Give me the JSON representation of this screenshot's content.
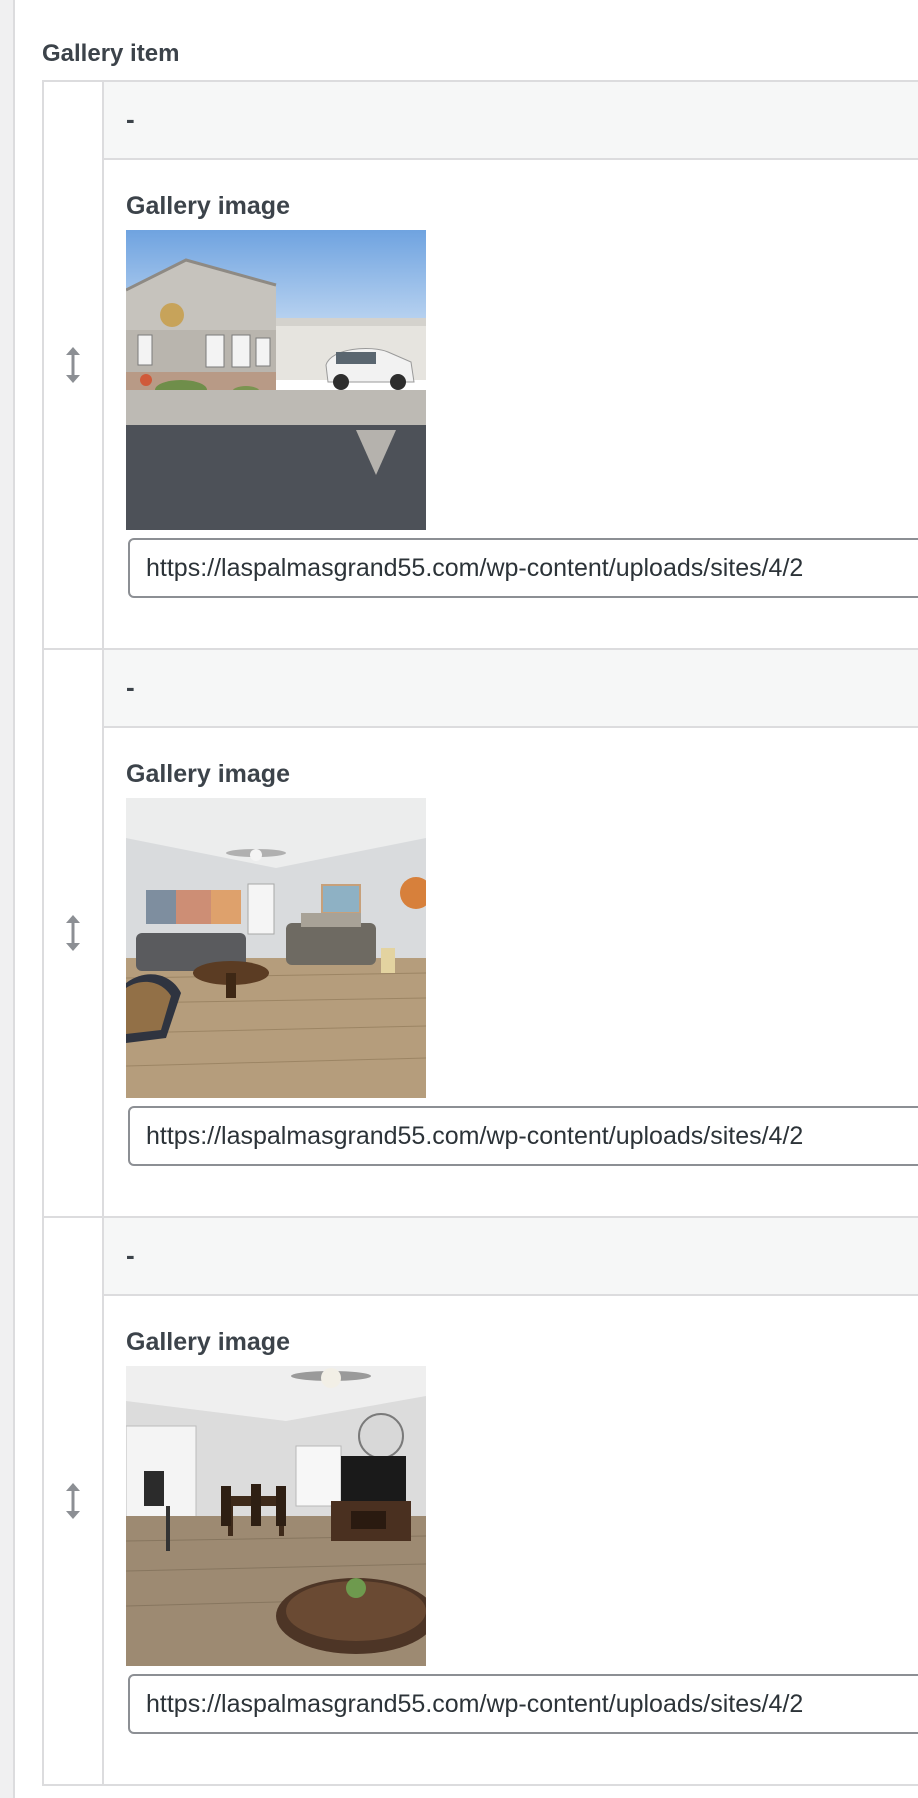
{
  "field": {
    "label": "Gallery item"
  },
  "rows": [
    {
      "title": "-",
      "image_label": "Gallery image",
      "url_value": "https://laspalmasgrand55.com/wp-content/uploads/sites/4/2",
      "image_icon": "house-exterior-photo"
    },
    {
      "title": "-",
      "image_label": "Gallery image",
      "url_value": "https://laspalmasgrand55.com/wp-content/uploads/sites/4/2",
      "image_icon": "living-room-photo"
    },
    {
      "title": "-",
      "image_label": "Gallery image",
      "url_value": "https://laspalmasgrand55.com/wp-content/uploads/sites/4/2",
      "image_icon": "kitchen-dining-photo"
    }
  ],
  "icons": {
    "drag_handle": "reorder-arrows-icon"
  },
  "colors": {
    "border": "#dcdcde",
    "header_bg": "#f6f7f7",
    "text": "#3c434a",
    "input_border": "#8c8f94"
  }
}
